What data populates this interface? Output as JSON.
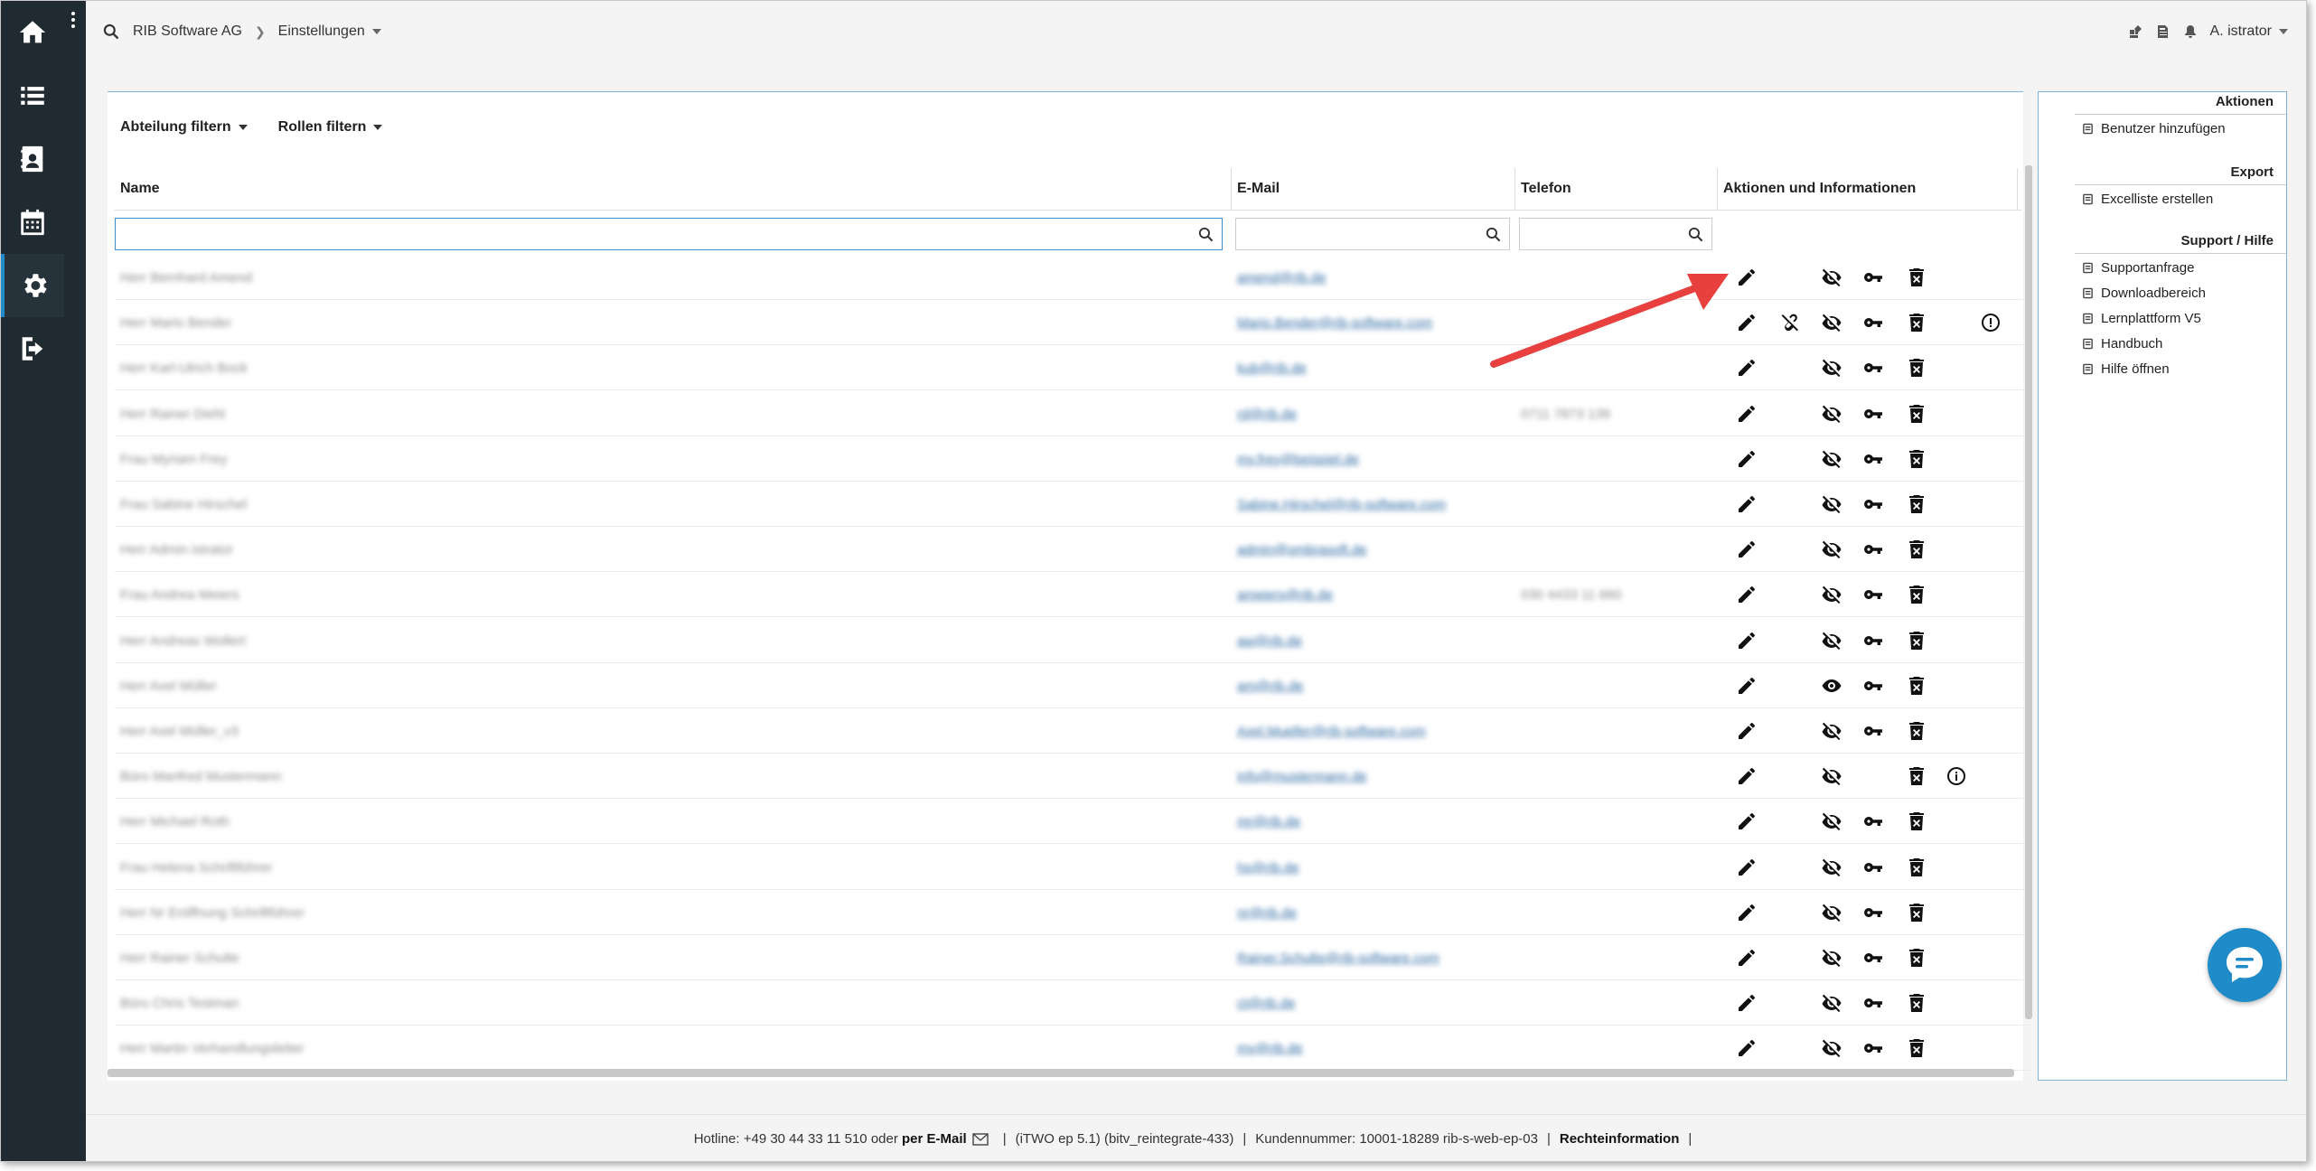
{
  "topbar": {
    "company": "RIB Software AG",
    "section": "Einstellungen",
    "user": "A. istrator"
  },
  "filters": {
    "department": "Abteilung filtern",
    "roles": "Rollen filtern"
  },
  "table": {
    "columns": [
      "Name",
      "E-Mail",
      "Telefon",
      "Aktionen und Informationen"
    ],
    "rows": [
      {
        "name": "Herr Bernhard Amend",
        "email": "amend@rib.de",
        "phone": "",
        "unlink": false,
        "visible": false,
        "key": true,
        "info": false,
        "warn": false
      },
      {
        "name": "Herr Mario Bender",
        "email": "Mario.Bender@rib-software.com",
        "phone": "",
        "unlink": true,
        "visible": false,
        "key": true,
        "info": false,
        "warn": true
      },
      {
        "name": "Herr Karl-Ulrich Bock",
        "email": "kub@rib.de",
        "phone": "",
        "unlink": false,
        "visible": false,
        "key": true,
        "info": false,
        "warn": false
      },
      {
        "name": "Herr Rainer Diehl",
        "email": "rd@rib.de",
        "phone": "0711 7873 139",
        "unlink": false,
        "visible": false,
        "key": true,
        "info": false,
        "warn": false
      },
      {
        "name": "Frau Myriam Frey",
        "email": "my.frey@beispiel.de",
        "phone": "",
        "unlink": false,
        "visible": false,
        "key": true,
        "info": false,
        "warn": false
      },
      {
        "name": "Frau Sabine Hirschel",
        "email": "Sabine.Hirschel@rib-software.com",
        "phone": "",
        "unlink": false,
        "visible": false,
        "key": true,
        "info": false,
        "warn": false
      },
      {
        "name": "Herr Admin istrator",
        "email": "admin@ombrasoft.de",
        "phone": "",
        "unlink": false,
        "visible": false,
        "key": true,
        "info": false,
        "warn": false
      },
      {
        "name": "Frau Andrea Meiers",
        "email": "ameiers@rib.de",
        "phone": "030 4433 11 660",
        "unlink": false,
        "visible": false,
        "key": true,
        "info": false,
        "warn": false
      },
      {
        "name": "Herr Andreas Wollert",
        "email": "aw@rib.de",
        "phone": "",
        "unlink": false,
        "visible": false,
        "key": true,
        "info": false,
        "warn": false
      },
      {
        "name": "Herr Axel Müller",
        "email": "am@rib.de",
        "phone": "",
        "unlink": false,
        "visible": true,
        "key": true,
        "info": false,
        "warn": false
      },
      {
        "name": "Herr Axel Müller_v3",
        "email": "Axel.Mueller@rib-software.com",
        "phone": "",
        "unlink": false,
        "visible": false,
        "key": true,
        "info": false,
        "warn": false
      },
      {
        "name": "Büro Manfred Mustermann",
        "email": "info@mustermann.de",
        "phone": "",
        "unlink": false,
        "visible": false,
        "key": false,
        "info": true,
        "warn": false
      },
      {
        "name": "Herr Michael Roth",
        "email": "mr@rib.de",
        "phone": "",
        "unlink": false,
        "visible": false,
        "key": true,
        "info": false,
        "warn": false
      },
      {
        "name": "Frau Helena Schriftführer",
        "email": "hs@rib.de",
        "phone": "",
        "unlink": false,
        "visible": false,
        "key": true,
        "info": false,
        "warn": false
      },
      {
        "name": "Herr Nr Eröffnung Schriftführer",
        "email": "nr@rib.de",
        "phone": "",
        "unlink": false,
        "visible": false,
        "key": true,
        "info": false,
        "warn": false
      },
      {
        "name": "Herr Rainer Schulte",
        "email": "Rainer.Schulte@rib-software.com",
        "phone": "",
        "unlink": false,
        "visible": false,
        "key": true,
        "info": false,
        "warn": false
      },
      {
        "name": "Büro Chris Testman",
        "email": "ct@rib.de",
        "phone": "",
        "unlink": false,
        "visible": false,
        "key": true,
        "info": false,
        "warn": false
      },
      {
        "name": "Herr Martin Verhandlungsleiter",
        "email": "mv@rib.de",
        "phone": "",
        "unlink": false,
        "visible": false,
        "key": true,
        "info": false,
        "warn": false
      }
    ]
  },
  "rightpanel": {
    "aktionen_title": "Aktionen",
    "aktionen_items": [
      "Benutzer hinzufügen"
    ],
    "export_title": "Export",
    "export_items": [
      "Excelliste erstellen"
    ],
    "support_title": "Support / Hilfe",
    "support_items": [
      "Supportanfrage",
      "Downloadbereich",
      "Lernplattform V5",
      "Handbuch",
      "Hilfe öffnen"
    ]
  },
  "footer": {
    "hotline": "Hotline: +49 30 44 33 11 510 oder",
    "email_link": "per E-Mail",
    "version": "(iTWO ep 5.1) (bitv_reintegrate-433)",
    "customer": "Kundennummer: 10001-18289 rib-s-web-ep-03",
    "legal": "Rechteinformation",
    "sep": "|"
  },
  "colors": {
    "nav_bg": "#202a31",
    "accent": "#1f8bc9",
    "arrow": "#e8403f"
  }
}
